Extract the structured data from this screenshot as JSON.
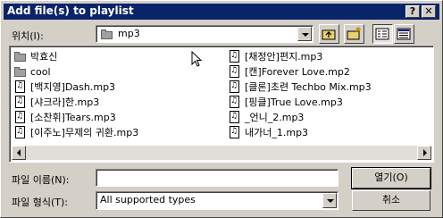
{
  "window": {
    "title": "Add file(s) to playlist",
    "help_glyph": "?",
    "close_glyph": "✕"
  },
  "location": {
    "label": "위치(I):",
    "value": "mp3"
  },
  "files": [
    {
      "name": "박효신",
      "kind": "folder"
    },
    {
      "name": "cool",
      "kind": "folder"
    },
    {
      "name": "[백지영]Dash.mp3",
      "kind": "file"
    },
    {
      "name": "[샤크라]한.mp3",
      "kind": "file"
    },
    {
      "name": "[소찬휘]Tears.mp3",
      "kind": "file"
    },
    {
      "name": "[이주노]무제의 귀환.mp3",
      "kind": "file"
    },
    {
      "name": "[채정안]편지.mp3",
      "kind": "file"
    },
    {
      "name": "[캔]Forever Love.mp2",
      "kind": "file"
    },
    {
      "name": "[클론]초련 Techbo Mix.mp3",
      "kind": "file"
    },
    {
      "name": "[핑클]True Love.mp3",
      "kind": "file"
    },
    {
      "name": "_언니_2.mp3",
      "kind": "file"
    },
    {
      "name": "내가너_1.mp3",
      "kind": "file"
    }
  ],
  "filename": {
    "label": "파일 이름(N):",
    "value": ""
  },
  "filetype": {
    "label": "파일 형식(T):",
    "value": "All supported types"
  },
  "buttons": {
    "open": "열기(O)",
    "cancel": "취소"
  },
  "colors": {
    "titlebar": "#0a246a",
    "face": "#d4d0c8"
  }
}
